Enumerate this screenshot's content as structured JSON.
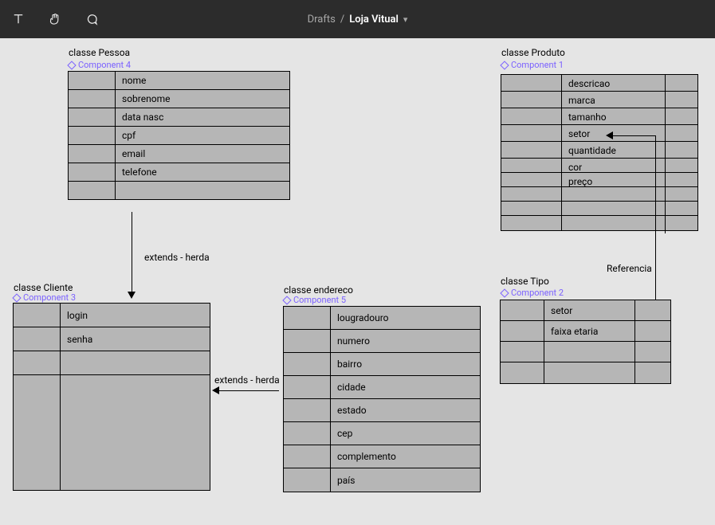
{
  "header": {
    "breadcrumb_root": "Drafts",
    "breadcrumb_title": "Loja Vitual"
  },
  "icons": {
    "text": "text-tool-icon",
    "hand": "hand-tool-icon",
    "comment": "comment-icon",
    "chevron": "chevron-down-icon"
  },
  "classes": {
    "pessoa": {
      "title": "classe Pessoa",
      "comp": "Component 4",
      "rows": [
        "nome",
        "sobrenome",
        "data nasc",
        "cpf",
        "email",
        "telefone",
        ""
      ]
    },
    "produto": {
      "title": "classe Produto",
      "comp": "Component 1",
      "rows": [
        "descricao",
        "marca",
        "tamanho",
        "setor",
        "quantidade",
        "cor",
        "preço",
        "",
        "",
        ""
      ]
    },
    "cliente": {
      "title": "classe Cliente",
      "comp": "Component 3",
      "rows": [
        "login",
        "senha",
        ""
      ]
    },
    "endereco": {
      "title": "classe endereco",
      "comp": "Component 5",
      "rows": [
        "lougradouro",
        "numero",
        "bairro",
        "cidade",
        "estado",
        "cep",
        "complemento",
        "país"
      ]
    },
    "tipo": {
      "title": "classe Tipo",
      "comp": "Component 2",
      "rows": [
        "setor",
        "faixa etaria",
        "",
        ""
      ]
    }
  },
  "edges": {
    "extends1": "extends - herda",
    "extends2": "extends - herda",
    "referencia": "Referencia"
  }
}
